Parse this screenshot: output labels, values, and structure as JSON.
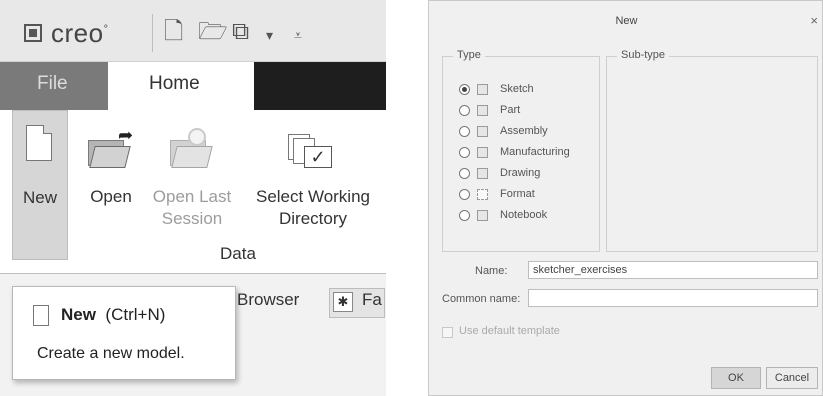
{
  "ribbon_panel": {
    "app_name": "creo",
    "app_name_mark": "°",
    "tabs": [
      {
        "label": "File",
        "active": false
      },
      {
        "label": "Home",
        "active": true
      }
    ],
    "buttons": {
      "new": "New",
      "open": "Open",
      "open_last_line1": "Open Last",
      "open_last_line2": "Session",
      "select_dir_line1": "Select Working",
      "select_dir_line2": "Directory"
    },
    "group_label": "Data",
    "browser_tab": "Browser",
    "favorites_tab_partial": "Fa",
    "tooltip": {
      "command": "New",
      "shortcut": "(Ctrl+N)",
      "description": "Create a new model."
    }
  },
  "new_dialog": {
    "title": "New",
    "close_glyph": "×",
    "type_group_label": "Type",
    "subtype_group_label": "Sub-type",
    "types": [
      {
        "label": "Sketch",
        "selected": true,
        "icon": "sketch-icon"
      },
      {
        "label": "Part",
        "selected": false,
        "icon": "part-icon"
      },
      {
        "label": "Assembly",
        "selected": false,
        "icon": "assembly-icon"
      },
      {
        "label": "Manufacturing",
        "selected": false,
        "icon": "manufacturing-icon"
      },
      {
        "label": "Drawing",
        "selected": false,
        "icon": "drawing-icon"
      },
      {
        "label": "Format",
        "selected": false,
        "icon": "format-icon"
      },
      {
        "label": "Notebook",
        "selected": false,
        "icon": "notebook-icon"
      }
    ],
    "name_label": "Name:",
    "name_value": "sketcher_exercises",
    "common_name_label": "Common name:",
    "common_name_value": "",
    "use_default_template_label": "Use default template",
    "use_default_template_checked": false,
    "ok_label": "OK",
    "cancel_label": "Cancel"
  }
}
